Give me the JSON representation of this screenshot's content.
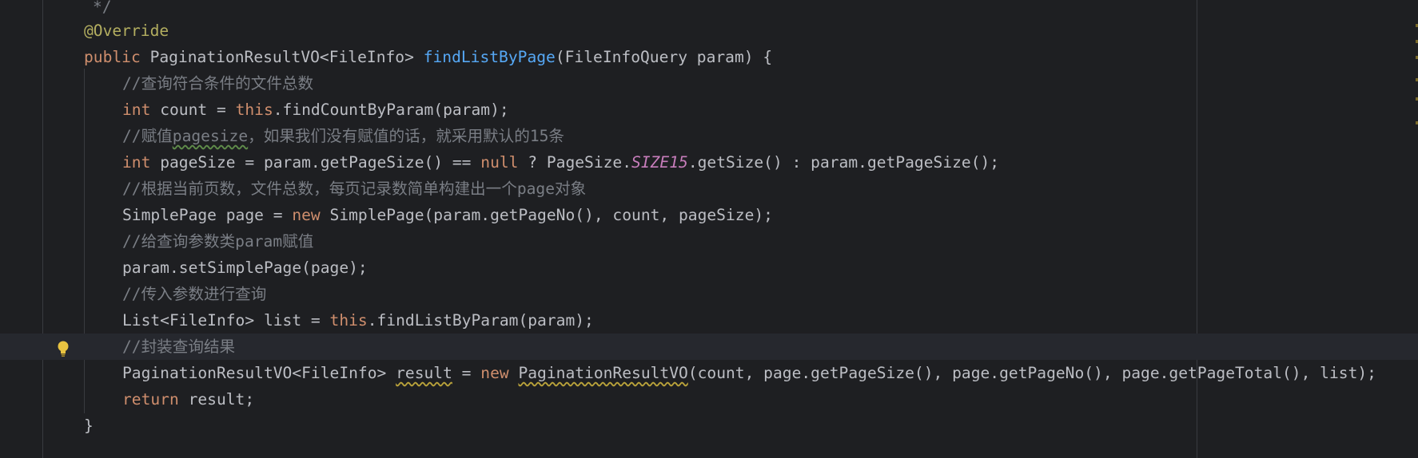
{
  "editor": {
    "lines": [
      {
        "id": "doc-end",
        "tokens": [
          {
            "t": "*/",
            "c": "cmt"
          }
        ]
      },
      {
        "id": "annotation",
        "tokens": [
          {
            "t": "@Override",
            "c": "ann"
          }
        ]
      },
      {
        "id": "method-signature",
        "tokens": [
          {
            "t": "public ",
            "c": "kw"
          },
          {
            "t": "PaginationResultVO<FileInfo> ",
            "c": ""
          },
          {
            "t": "findListByPage",
            "c": "fn"
          },
          {
            "t": "(FileInfoQuery param) {",
            "c": ""
          }
        ]
      },
      {
        "id": "comment-count",
        "tokens": [
          {
            "t": "//查询符合条件的文件总数",
            "c": "cmt"
          }
        ]
      },
      {
        "id": "count-decl",
        "tokens": [
          {
            "t": "int ",
            "c": "kw"
          },
          {
            "t": "count = ",
            "c": ""
          },
          {
            "t": "this",
            "c": "kw"
          },
          {
            "t": ".findCountByParam(param);",
            "c": ""
          }
        ]
      },
      {
        "id": "comment-pagesize",
        "tokens": [
          {
            "t": "//赋值",
            "c": "cmt"
          },
          {
            "t": "pagesize",
            "c": "cmt squiggle-green"
          },
          {
            "t": "，如果我们没有赋值的话，就采用默认的15条",
            "c": "cmt"
          }
        ]
      },
      {
        "id": "pagesize-decl",
        "tokens": [
          {
            "t": "int ",
            "c": "kw"
          },
          {
            "t": "pageSize = param.getPageSize() == ",
            "c": ""
          },
          {
            "t": "null",
            "c": "kw"
          },
          {
            "t": " ? PageSize.",
            "c": ""
          },
          {
            "t": "SIZE15",
            "c": "static"
          },
          {
            "t": ".getSize() : param.getPageSize();",
            "c": ""
          }
        ]
      },
      {
        "id": "comment-page",
        "tokens": [
          {
            "t": "//根据当前页数，文件总数，每页记录数简单构建出一个page对象",
            "c": "cmt"
          }
        ]
      },
      {
        "id": "page-decl",
        "tokens": [
          {
            "t": "SimplePage page = ",
            "c": ""
          },
          {
            "t": "new ",
            "c": "kw"
          },
          {
            "t": "SimplePage(param.getPageNo(), count, pageSize);",
            "c": ""
          }
        ]
      },
      {
        "id": "comment-param",
        "tokens": [
          {
            "t": "//给查询参数类param赋值",
            "c": "cmt"
          }
        ]
      },
      {
        "id": "set-page",
        "tokens": [
          {
            "t": "param.setSimplePage(page);",
            "c": ""
          }
        ]
      },
      {
        "id": "comment-query",
        "tokens": [
          {
            "t": "//传入参数进行查询",
            "c": "cmt"
          }
        ]
      },
      {
        "id": "list-decl",
        "tokens": [
          {
            "t": "List<FileInfo> list = ",
            "c": ""
          },
          {
            "t": "this",
            "c": "kw"
          },
          {
            "t": ".findListByParam(param);",
            "c": ""
          }
        ]
      },
      {
        "id": "comment-result",
        "tokens": [
          {
            "t": "//封装查询结果",
            "c": "cmt"
          }
        ]
      },
      {
        "id": "result-decl",
        "tokens": [
          {
            "t": "PaginationResultVO<FileInfo> ",
            "c": ""
          },
          {
            "t": "result",
            "c": "squiggle-yellow"
          },
          {
            "t": " = ",
            "c": ""
          },
          {
            "t": "new ",
            "c": "kw"
          },
          {
            "t": "PaginationResultVO",
            "c": "squiggle-yellow"
          },
          {
            "t": "(count, page.getPageSize(), page.getPageNo(), page.getPageTotal(), list);",
            "c": ""
          }
        ]
      },
      {
        "id": "return",
        "tokens": [
          {
            "t": "return ",
            "c": "kw"
          },
          {
            "t": "result;",
            "c": ""
          }
        ]
      },
      {
        "id": "close-brace",
        "tokens": [
          {
            "t": "}",
            "c": ""
          }
        ]
      }
    ],
    "colors": {
      "background": "#1e1f22",
      "keyword": "#cf8e6d",
      "annotation": "#b3ae60",
      "method": "#56a8f5",
      "comment": "#7a7e85",
      "static_field": "#c77dbb",
      "text": "#bcbec4"
    },
    "intention_icon": "lightbulb-icon"
  }
}
